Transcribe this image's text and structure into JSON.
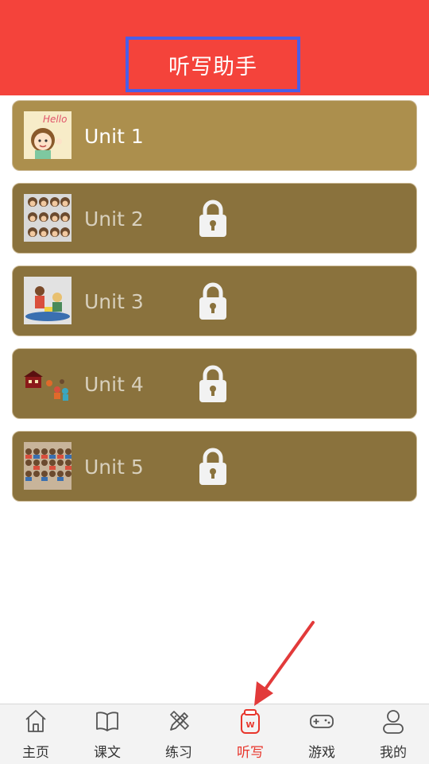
{
  "header": {
    "title": "听写助手"
  },
  "units": [
    {
      "label": "Unit 1",
      "locked": false,
      "thumb_icon": "hello-girl-icon"
    },
    {
      "label": "Unit 2",
      "locked": true,
      "thumb_icon": "faces-grid-icon"
    },
    {
      "label": "Unit 3",
      "locked": true,
      "thumb_icon": "children-playing-icon"
    },
    {
      "label": "Unit 4",
      "locked": true,
      "thumb_icon": "school-scene-icon"
    },
    {
      "label": "Unit 5",
      "locked": true,
      "thumb_icon": "crowd-icon"
    }
  ],
  "tabs": [
    {
      "label": "主页",
      "icon": "home-icon",
      "active": false
    },
    {
      "label": "课文",
      "icon": "book-icon",
      "active": false
    },
    {
      "label": "练习",
      "icon": "pencil-ruler-icon",
      "active": false
    },
    {
      "label": "听写",
      "icon": "dictation-cup-icon",
      "active": true
    },
    {
      "label": "游戏",
      "icon": "gamepad-icon",
      "active": false
    },
    {
      "label": "我的",
      "icon": "user-icon",
      "active": false
    }
  ],
  "colors": {
    "header": "#f4433b",
    "highlight_box": "#4a5ee8",
    "unit_active": "#ac8f4d",
    "unit_locked": "#8a723d",
    "tab_active": "#e8352b",
    "annotation_arrow": "#e23a3a"
  }
}
